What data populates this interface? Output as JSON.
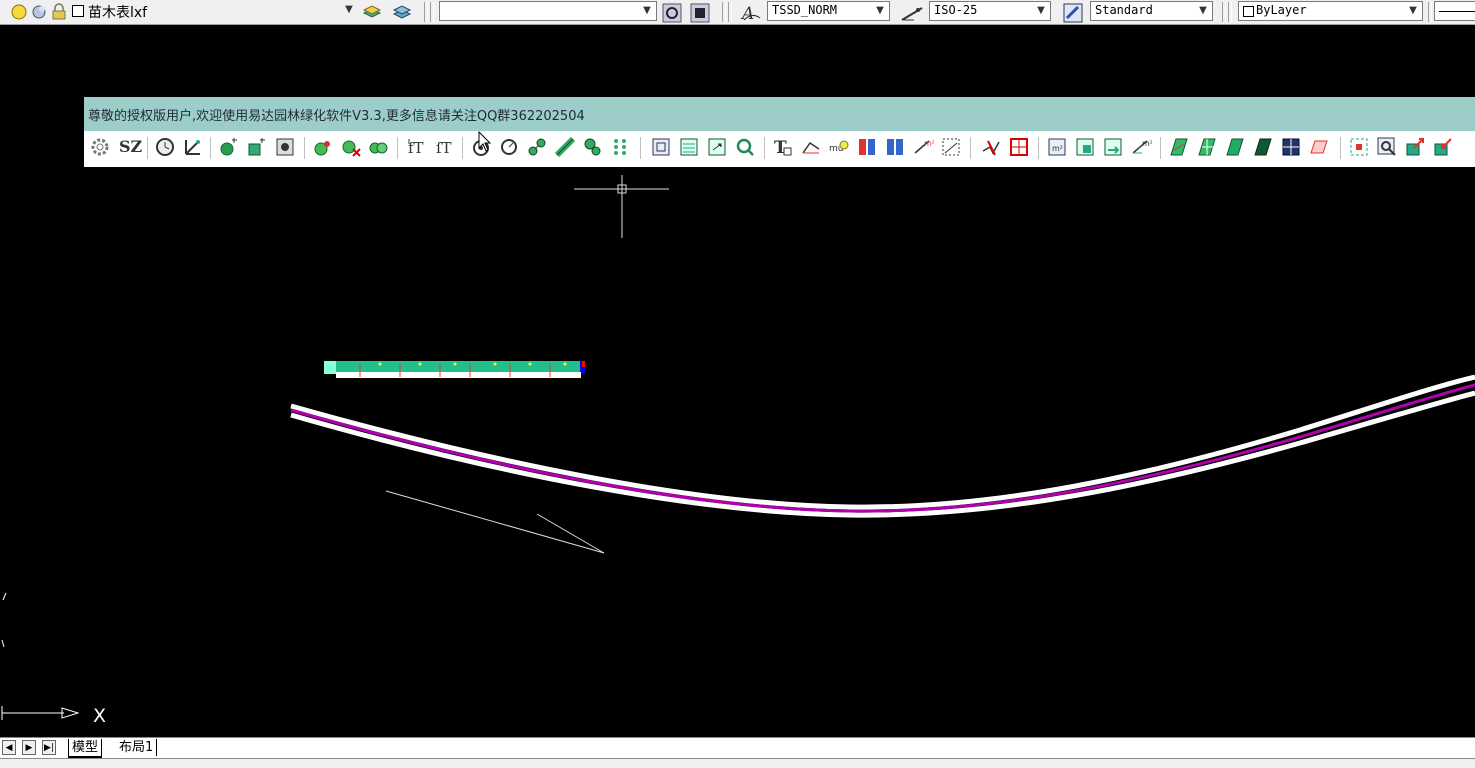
{
  "toolbar": {
    "layer_name": "苗木表lxf",
    "text_style": "TSSD_NORM",
    "dim_style": "ISO-25",
    "table_style": "Standard",
    "color": "ByLayer",
    "empty_combo": ""
  },
  "plugin_panel": {
    "title": "尊敬的授权版用户,欢迎使用易达园林绿化软件V3.3,更多信息请关注QQ群362202504",
    "sz_label": "SZ"
  },
  "canvas": {
    "ucs_x_label": "X",
    "background": "#000000",
    "road_color": "#ffffff",
    "road_center_color": "#b000b0"
  },
  "layout_tabs": {
    "model": "模型",
    "layout1": "布局1"
  },
  "icons": [
    "gear-icon",
    "sz-text-icon",
    "clock-icon",
    "coordinate-icon",
    "tree-icon",
    "shrub-icon",
    "crosshair-cursor-icon",
    "pointer-cursor-icon"
  ]
}
